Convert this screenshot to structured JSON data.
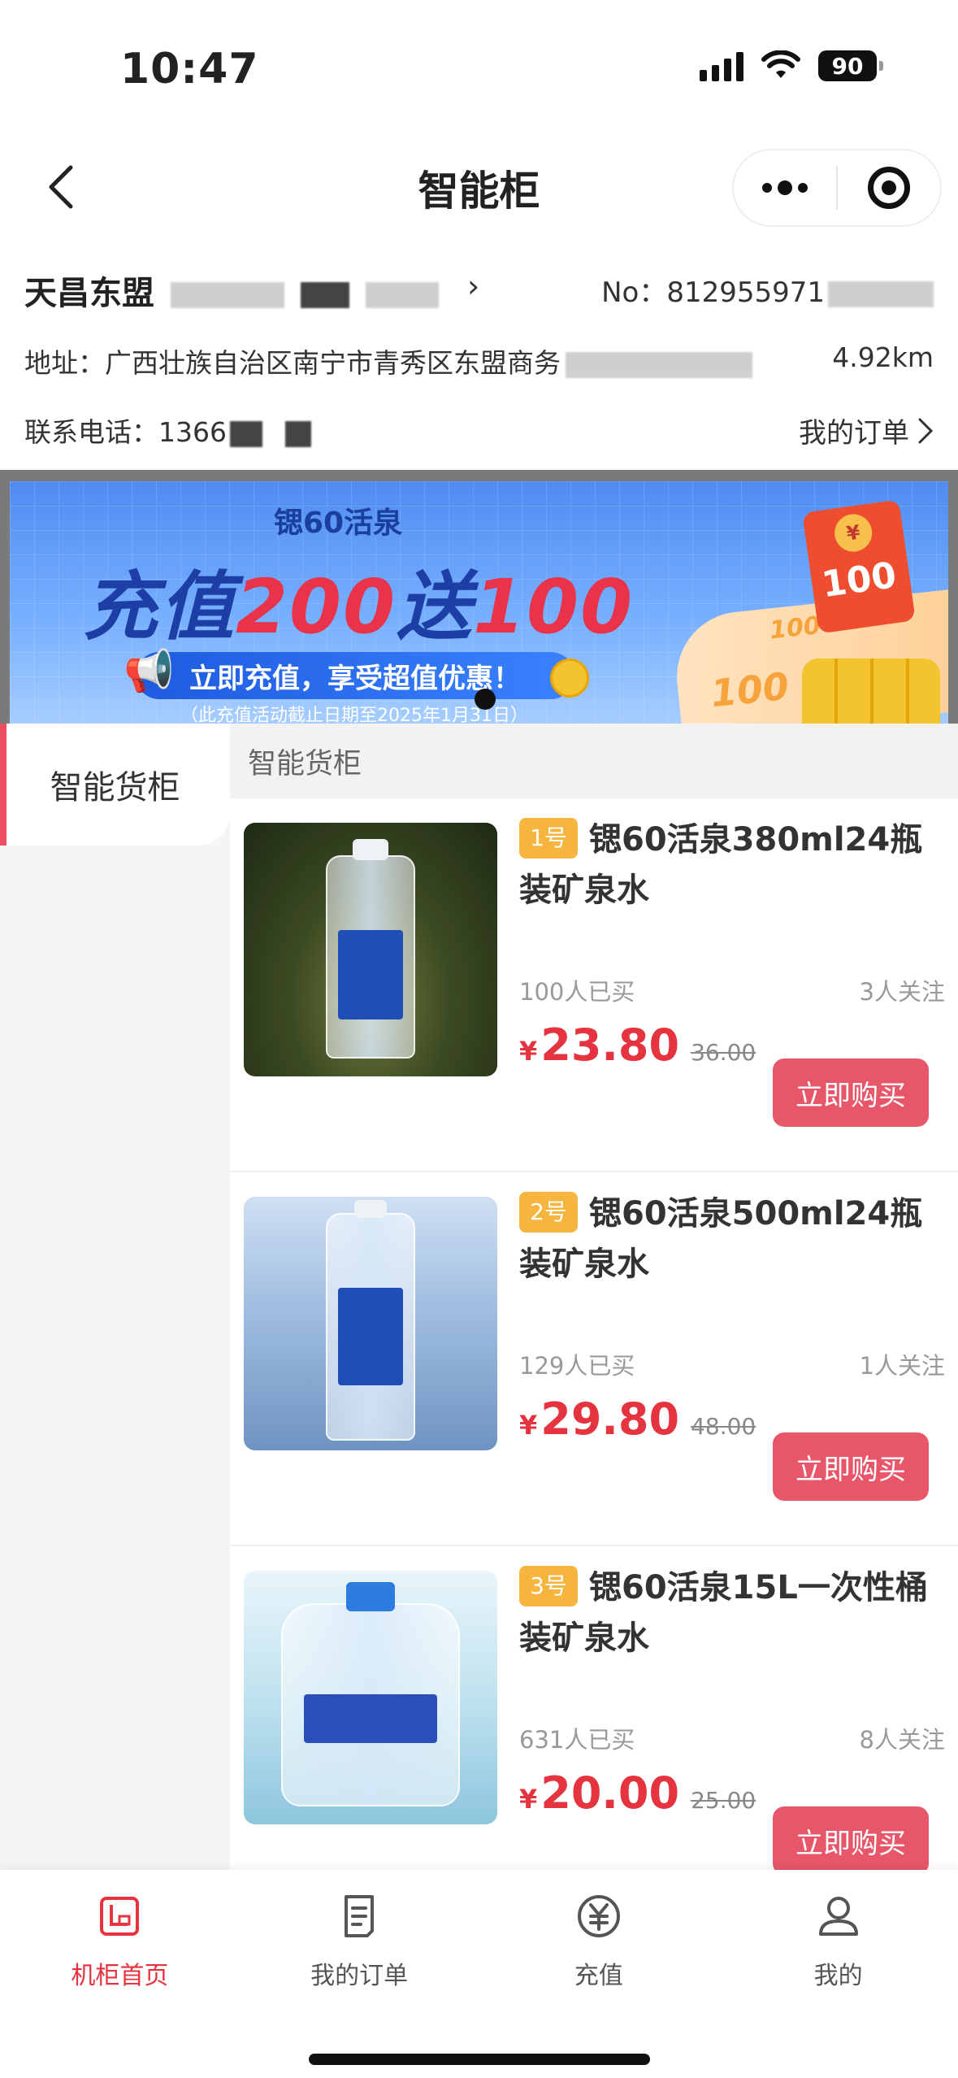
{
  "status": {
    "time": "10:47",
    "battery": "90"
  },
  "nav": {
    "title": "智能柜"
  },
  "store": {
    "name": "天昌东盟",
    "no": "No：812955971",
    "address": "地址：广西壮族自治区南宁市青秀区东盟商务",
    "distance": "4.92km",
    "phone": "联系电话：1366",
    "orders_link": "我的订单"
  },
  "banner": {
    "brand": "锶60活泉",
    "headline_prefix": "充值",
    "headline_amount": "200",
    "headline_mid": "送",
    "headline_bonus": "100",
    "subline": "立即充值，享受超值优惠！",
    "footnote": "（此充值活动截止日期至2025年1月31日）",
    "packet_amount": "100",
    "ribbon_values": [
      "100",
      "100",
      "100",
      "100"
    ]
  },
  "sidebar": {
    "category": "智能货柜"
  },
  "section_header": "智能货柜",
  "products": [
    {
      "badge": "1号",
      "name": "锶60活泉380ml24瓶装矿泉水",
      "bought": "100人已买",
      "follow": "3人关注",
      "currency": "¥",
      "price": "23.80",
      "original": "36.00",
      "buy_label": "立即购买"
    },
    {
      "badge": "2号",
      "name": "锶60活泉500ml24瓶装矿泉水",
      "bought": "129人已买",
      "follow": "1人关注",
      "currency": "¥",
      "price": "29.80",
      "original": "48.00",
      "buy_label": "立即购买"
    },
    {
      "badge": "3号",
      "name": "锶60活泉15L一次性桶装矿泉水",
      "bought": "631人已买",
      "follow": "8人关注",
      "currency": "¥",
      "price": "20.00",
      "original": "25.00",
      "buy_label": "立即购买"
    }
  ],
  "tabbar": [
    {
      "label": "机柜首页",
      "icon": "cabinet-icon",
      "active": true
    },
    {
      "label": "我的订单",
      "icon": "order-list-icon",
      "active": false
    },
    {
      "label": "充值",
      "icon": "yuan-coin-icon",
      "active": false
    },
    {
      "label": "我的",
      "icon": "user-icon",
      "active": false
    }
  ],
  "colors": {
    "accent": "#e5333f",
    "buy_button": "#e8566a",
    "badge": "#f6b53e"
  }
}
